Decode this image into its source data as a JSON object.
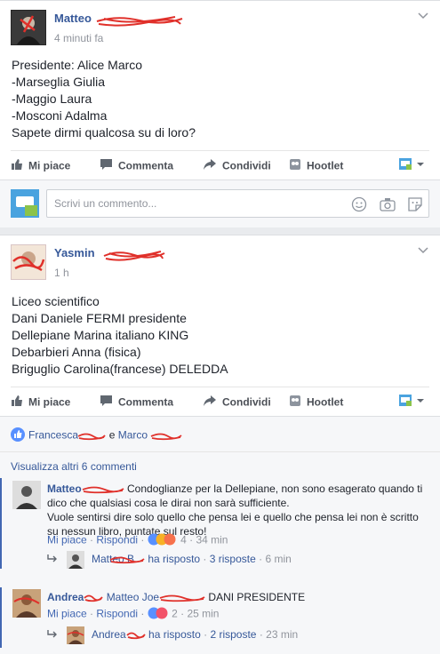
{
  "posts": [
    {
      "author_visible": "Matteo",
      "time": "4 minuti fa",
      "body": [
        "Presidente: Alice Marco",
        "-Marseglia Giulia",
        "-Maggio Laura",
        "-Mosconi Adalma",
        "Sapete dirmi qualcosa su di loro?"
      ],
      "actions": {
        "like": "Mi piace",
        "comment": "Commenta",
        "share": "Condividi",
        "hootlet": "Hootlet"
      },
      "comment_placeholder": "Scrivi un commento..."
    },
    {
      "author_visible": "Yasmin",
      "time": "1 h",
      "body": [
        "Liceo scientifico",
        "Dani Daniele FERMI presidente",
        "Dellepiane Marina italiano KING",
        "Debarbieri Anna (fisica)",
        "Briguglio Carolina(francese) DELEDDA"
      ],
      "actions": {
        "like": "Mi piace",
        "comment": "Commenta",
        "share": "Condividi",
        "hootlet": "Hootlet"
      },
      "likers": {
        "first": "Francesca",
        "sep": "e",
        "second": "Marco"
      },
      "view_more": "Visualizza altri 6 commenti",
      "comments": [
        {
          "name": "Matteo",
          "text": "Condoglianze per la Dellepiane, non sono esagerato quando ti dico che qualsiasi cosa le dirai non sarà sufficiente.",
          "text2": "Vuole sentirsi dire solo quello che pensa lei e quello che pensa lei non è scritto su nessun libro, puntate sul resto!",
          "like_label": "Mi piace",
          "reply_label": "Rispondi",
          "reaction_count": "4",
          "time": "34 min",
          "reply_summary": {
            "name": "Matteo B",
            "action": "ha risposto",
            "count": "3 risposte",
            "time": "6 min"
          }
        },
        {
          "name": "Andrea",
          "mention": "Matteo Joe",
          "text": "DANI PRESIDENTE",
          "like_label": "Mi piace",
          "reply_label": "Rispondi",
          "reaction_count": "2",
          "time": "25 min",
          "reply_summary": {
            "name": "Andrea",
            "action": "ha risposto",
            "count": "2 risposte",
            "time": "23 min"
          }
        }
      ]
    }
  ],
  "icons": {
    "like": "thumbs-up-icon",
    "comment": "speech-bubble-icon",
    "share": "share-arrow-icon",
    "hootlet": "hootlet-owl-icon",
    "emoji": "smiley-icon",
    "camera": "camera-icon",
    "sticker": "sticker-icon"
  },
  "colors": {
    "link": "#365899",
    "meta": "#90949c",
    "accent": "#4267b2",
    "redaction": "#e0302a"
  }
}
